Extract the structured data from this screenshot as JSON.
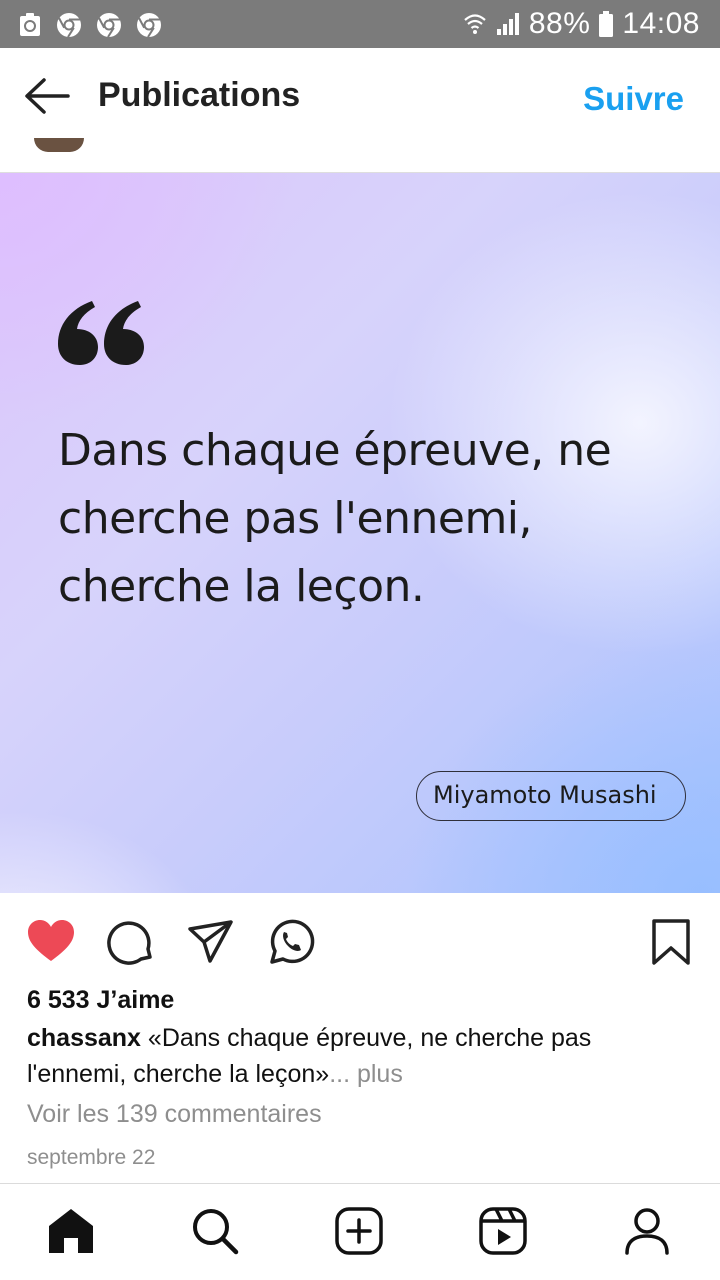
{
  "status_bar": {
    "battery": "88%",
    "time": "14:08",
    "icons": [
      "android-recycle-icon",
      "chrome-icon",
      "chrome-icon",
      "chrome-icon",
      "wifi-icon",
      "signal-icon",
      "battery-icon"
    ]
  },
  "header": {
    "title": "Publications",
    "follow_label": "Suivre",
    "back_icon": "arrow-left-icon"
  },
  "post": {
    "quote_text": "Dans chaque épreuve, ne cherche pas l'ennemi, cherche la leçon.",
    "author": "Miyamoto Musashi",
    "likes": "6 533 J’aime",
    "username": "chassanx",
    "caption": " «Dans chaque épreuve, ne cherche pas l'ennemi, cherche la leçon»",
    "more_label": "... plus",
    "comments_label": "Voir les 139 commentaires",
    "date": "septembre 22"
  },
  "actions": {
    "icons": [
      "heart-icon",
      "comment-icon",
      "share-icon",
      "whatsapp-icon",
      "bookmark-icon"
    ],
    "heart_color": "#ed4956"
  },
  "bottom_nav": {
    "items": [
      "home-icon",
      "search-icon",
      "create-icon",
      "reels-icon",
      "profile-icon"
    ]
  },
  "colors": {
    "accent": "#1aa0f0",
    "status_bar": "#7b7b7b"
  }
}
